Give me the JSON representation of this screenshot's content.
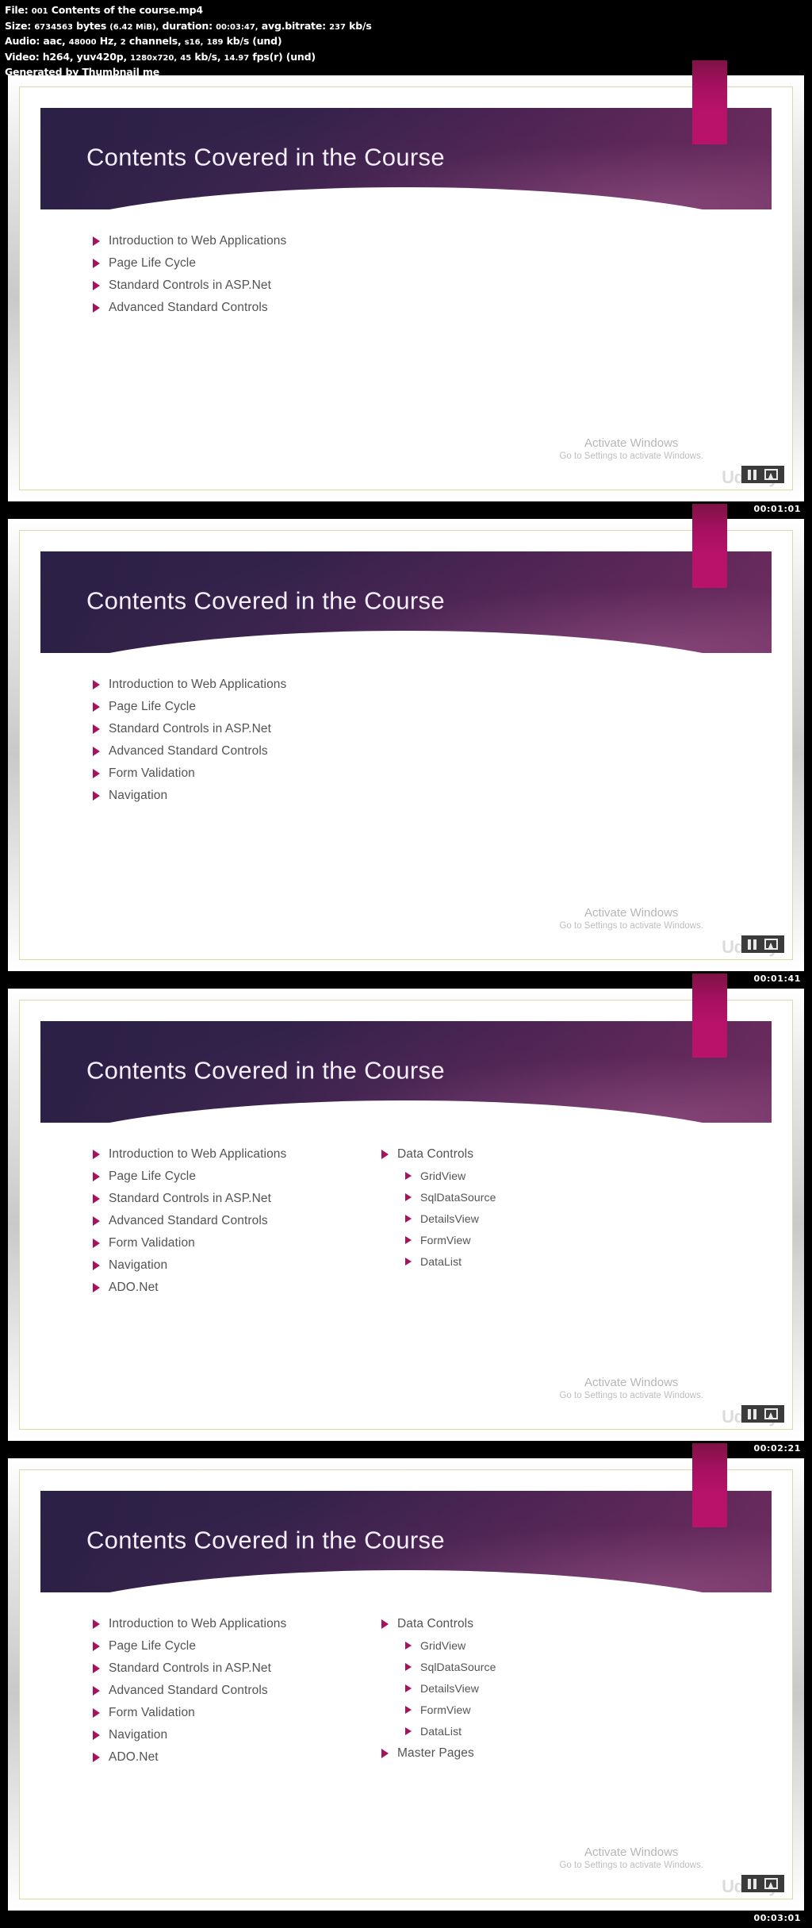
{
  "meta": {
    "file_label": "File:",
    "file_value": "001 Contents of the course.mp4",
    "size_label": "Size:",
    "size_value": "6734563",
    "size_unit": "bytes",
    "size_human": "(6.42 MiB),",
    "duration_label": "duration:",
    "duration_value": "00:03:47,",
    "bitrate_label": "avg.bitrate:",
    "bitrate_value": "237",
    "bitrate_unit": "kb/s",
    "audio_label": "Audio:",
    "audio_codec": "aac,",
    "audio_rate": "48000",
    "audio_rate_unit": "Hz,",
    "audio_channels_n": "2",
    "audio_channels": "channels,",
    "audio_fmt": "s16,",
    "audio_bitrate": "189",
    "audio_bitrate_unit": "kb/s (und)",
    "video_label": "Video:",
    "video_codec": "h264,",
    "video_pixfmt": "yuv420p,",
    "video_res": "1280x720,",
    "video_bitrate": "45",
    "video_bitrate_unit": "kb/s,",
    "video_fps": "14.97",
    "video_fps_unit": "fps(r) (und)",
    "generated_by": "Generated by Thumbnail me"
  },
  "colors": {
    "accent_magenta": "#a8115c",
    "tab_pink": "#b8126a",
    "banner_dark": "#2b2045",
    "banner_light": "#6a2a5c",
    "bullet_text": "#555252",
    "frame_border": "#ded9a8"
  },
  "watermark": {
    "activate_title": "Activate Windows",
    "activate_sub": "Go to Settings to activate Windows.",
    "brand": "Udemy",
    "pause_icon": "pause-icon",
    "screen_icon": "present-screen-icon"
  },
  "slides": [
    {
      "title": "Contents Covered in the Course",
      "timestamp": "00:01:01",
      "left_column": [
        {
          "text": "Introduction to Web Applications",
          "level": 1
        },
        {
          "text": "Page Life Cycle",
          "level": 1
        },
        {
          "text": "Standard Controls in ASP.Net",
          "level": 1
        },
        {
          "text": "Advanced Standard Controls",
          "level": 1
        }
      ],
      "right_column": []
    },
    {
      "title": "Contents Covered in the Course",
      "timestamp": "00:01:41",
      "left_column": [
        {
          "text": "Introduction to Web Applications",
          "level": 1
        },
        {
          "text": "Page Life Cycle",
          "level": 1
        },
        {
          "text": "Standard Controls in ASP.Net",
          "level": 1
        },
        {
          "text": "Advanced Standard Controls",
          "level": 1
        },
        {
          "text": "Form Validation",
          "level": 1
        },
        {
          "text": "Navigation",
          "level": 1
        }
      ],
      "right_column": []
    },
    {
      "title": "Contents Covered in the Course",
      "timestamp": "00:02:21",
      "left_column": [
        {
          "text": "Introduction to Web Applications",
          "level": 1
        },
        {
          "text": "Page Life Cycle",
          "level": 1
        },
        {
          "text": "Standard Controls in ASP.Net",
          "level": 1
        },
        {
          "text": "Advanced Standard Controls",
          "level": 1
        },
        {
          "text": "Form Validation",
          "level": 1
        },
        {
          "text": "Navigation",
          "level": 1
        },
        {
          "text": "ADO.Net",
          "level": 1
        }
      ],
      "right_column": [
        {
          "text": "Data Controls",
          "level": 1
        },
        {
          "text": "GridView",
          "level": 2
        },
        {
          "text": "SqlDataSource",
          "level": 2
        },
        {
          "text": "DetailsView",
          "level": 2
        },
        {
          "text": "FormView",
          "level": 2
        },
        {
          "text": "DataList",
          "level": 2
        }
      ]
    },
    {
      "title": "Contents Covered in the Course",
      "timestamp": "00:03:01",
      "left_column": [
        {
          "text": "Introduction to Web Applications",
          "level": 1
        },
        {
          "text": "Page Life Cycle",
          "level": 1
        },
        {
          "text": "Standard Controls in ASP.Net",
          "level": 1
        },
        {
          "text": "Advanced Standard Controls",
          "level": 1
        },
        {
          "text": "Form Validation",
          "level": 1
        },
        {
          "text": "Navigation",
          "level": 1
        },
        {
          "text": "ADO.Net",
          "level": 1
        }
      ],
      "right_column": [
        {
          "text": "Data Controls",
          "level": 1
        },
        {
          "text": "GridView",
          "level": 2
        },
        {
          "text": "SqlDataSource",
          "level": 2
        },
        {
          "text": "DetailsView",
          "level": 2
        },
        {
          "text": "FormView",
          "level": 2
        },
        {
          "text": "DataList",
          "level": 2
        },
        {
          "text": "Master Pages",
          "level": 1
        }
      ]
    }
  ]
}
